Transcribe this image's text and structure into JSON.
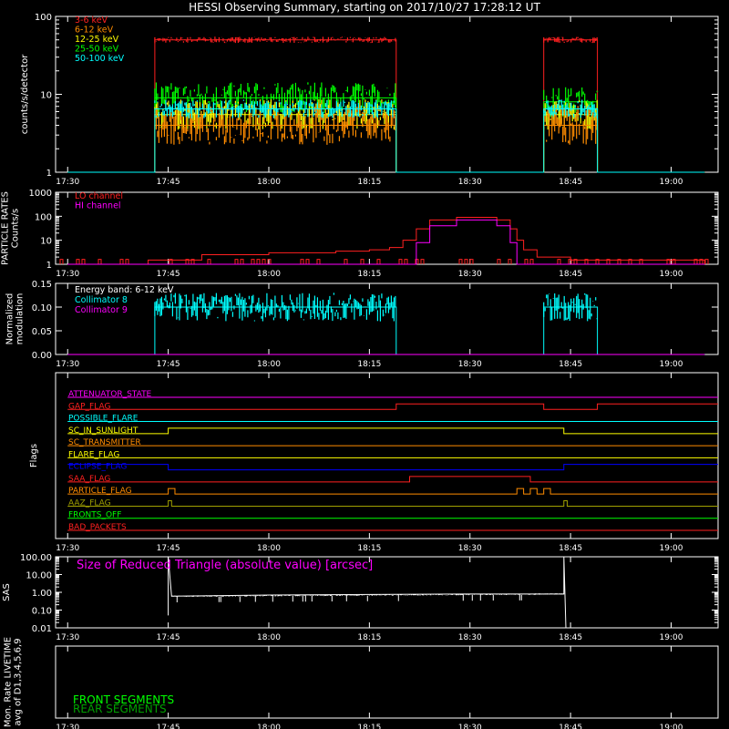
{
  "title": "HESSI Observing Summary, starting on 2017/10/27 17:28:12 UT",
  "time_ticks": [
    "17:30",
    "17:45",
    "18:00",
    "18:15",
    "18:30",
    "18:45",
    "19:00"
  ],
  "colors": {
    "red": "#ff2020",
    "orange": "#ff8c00",
    "yellow": "#ffff00",
    "green": "#00ff00",
    "cyan": "#00ffff",
    "magenta": "#ff00ff",
    "blue": "#0000ff",
    "white": "#ffffff",
    "olive": "#a0a000",
    "darkgreen": "#00a000"
  },
  "chart_data": [
    {
      "type": "line",
      "name": "count-rates",
      "ylabel": "counts/s/detector",
      "yscale": "log",
      "ylim": [
        1,
        100
      ],
      "ytick_labels": [
        "1",
        "10",
        "100"
      ],
      "x_unit": "UT time",
      "series": [
        {
          "name": "3-6 keV",
          "color": "red",
          "noise": 0.04,
          "points": [
            [
              "17:30",
              1
            ],
            [
              "17:43",
              1
            ],
            [
              "17:43",
              50
            ],
            [
              "18:19",
              50
            ],
            [
              "18:19",
              1
            ],
            [
              "18:41",
              1
            ],
            [
              "18:41",
              50
            ],
            [
              "18:49",
              50
            ],
            [
              "18:49",
              1
            ],
            [
              "19:05",
              1
            ]
          ]
        },
        {
          "name": "6-12 keV",
          "color": "orange",
          "noise": 0.25,
          "points": [
            [
              "17:30",
              1
            ],
            [
              "17:43",
              1
            ],
            [
              "17:43",
              4
            ],
            [
              "18:19",
              4
            ],
            [
              "18:19",
              1
            ],
            [
              "18:41",
              1
            ],
            [
              "18:41",
              4
            ],
            [
              "18:49",
              4
            ],
            [
              "18:49",
              1
            ],
            [
              "19:05",
              1
            ]
          ]
        },
        {
          "name": "12-25 keV",
          "color": "yellow",
          "noise": 0.2,
          "points": [
            [
              "17:30",
              1
            ],
            [
              "17:43",
              1
            ],
            [
              "17:43",
              5.5
            ],
            [
              "18:19",
              5.5
            ],
            [
              "18:19",
              1
            ],
            [
              "18:41",
              1
            ],
            [
              "18:41",
              5.5
            ],
            [
              "18:49",
              5.5
            ],
            [
              "18:49",
              1
            ],
            [
              "19:05",
              1
            ]
          ]
        },
        {
          "name": "25-50 keV",
          "color": "green",
          "noise": 0.2,
          "points": [
            [
              "17:30",
              1
            ],
            [
              "17:43",
              1
            ],
            [
              "17:43",
              9
            ],
            [
              "18:19",
              9
            ],
            [
              "18:19",
              1
            ],
            [
              "18:41",
              1
            ],
            [
              "18:41",
              8
            ],
            [
              "18:49",
              8
            ],
            [
              "18:49",
              1
            ],
            [
              "19:05",
              1
            ]
          ]
        },
        {
          "name": "50-100 keV",
          "color": "cyan",
          "noise": 0.12,
          "points": [
            [
              "17:30",
              1
            ],
            [
              "17:43",
              1
            ],
            [
              "17:43",
              6.5
            ],
            [
              "18:19",
              6.5
            ],
            [
              "18:19",
              1
            ],
            [
              "18:41",
              1
            ],
            [
              "18:41",
              6.5
            ],
            [
              "18:49",
              6.5
            ],
            [
              "18:49",
              1
            ],
            [
              "19:05",
              1
            ]
          ]
        }
      ]
    },
    {
      "type": "line",
      "name": "particle-rates",
      "ylabel": "PARTICLE RATES Counts/s",
      "yscale": "log",
      "ylim": [
        1,
        1000
      ],
      "ytick_labels": [
        "1",
        "10",
        "100",
        "1000"
      ],
      "series": [
        {
          "name": "LO channel",
          "color": "red",
          "points": [
            [
              "17:30",
              1
            ],
            [
              "17:42",
              1.5
            ],
            [
              "17:50",
              2.5
            ],
            [
              "18:00",
              3
            ],
            [
              "18:10",
              3.5
            ],
            [
              "18:15",
              4
            ],
            [
              "18:18",
              5
            ],
            [
              "18:20",
              10
            ],
            [
              "18:22",
              30
            ],
            [
              "18:24",
              70
            ],
            [
              "18:28",
              90
            ],
            [
              "18:32",
              90
            ],
            [
              "18:34",
              70
            ],
            [
              "18:36",
              30
            ],
            [
              "18:37",
              10
            ],
            [
              "18:38",
              4
            ],
            [
              "18:40",
              2
            ],
            [
              "18:45",
              1.5
            ],
            [
              "19:05",
              1
            ]
          ]
        },
        {
          "name": "HI channel",
          "color": "magenta",
          "points": [
            [
              "17:30",
              1
            ],
            [
              "18:21",
              1
            ],
            [
              "18:22",
              8
            ],
            [
              "18:24",
              40
            ],
            [
              "18:28",
              70
            ],
            [
              "18:32",
              70
            ],
            [
              "18:34",
              40
            ],
            [
              "18:36",
              8
            ],
            [
              "18:37",
              1
            ],
            [
              "19:05",
              1
            ]
          ]
        }
      ]
    },
    {
      "type": "line",
      "name": "modulation",
      "ylabel": "Normalized modulation",
      "ylim": [
        0.0,
        0.15
      ],
      "ytick_labels": [
        "0.00",
        "0.05",
        "0.10",
        "0.15"
      ],
      "annotation": "Energy band: 6-12 keV",
      "series": [
        {
          "name": "Collimator 8",
          "color": "cyan",
          "noise": 0.03,
          "points": [
            [
              "17:30",
              0
            ],
            [
              "17:43",
              0
            ],
            [
              "17:43",
              0.1
            ],
            [
              "18:19",
              0.1
            ],
            [
              "18:19",
              0
            ],
            [
              "18:41",
              0
            ],
            [
              "18:41",
              0.1
            ],
            [
              "18:49",
              0.1
            ],
            [
              "18:49",
              0
            ],
            [
              "19:05",
              0
            ]
          ]
        },
        {
          "name": "Collimator 9",
          "color": "magenta",
          "points": [
            [
              "17:30",
              0
            ],
            [
              "19:05",
              0
            ]
          ]
        }
      ]
    },
    {
      "type": "line",
      "name": "flags",
      "ylabel": "Flags",
      "series": [
        {
          "name": "ATTENUATOR_STATE",
          "color": "magenta",
          "segments": [
            [
              "17:30",
              0
            ],
            [
              "19:05",
              0
            ]
          ]
        },
        {
          "name": "GAP_FLAG",
          "color": "red",
          "segments": [
            [
              "17:30",
              0
            ],
            [
              "18:19",
              1
            ],
            [
              "18:41",
              0
            ],
            [
              "18:49",
              1
            ]
          ]
        },
        {
          "name": "POSSIBLE_FLARE",
          "color": "cyan",
          "segments": [
            [
              "17:30",
              0
            ]
          ]
        },
        {
          "name": "SC_IN_SUNLIGHT",
          "color": "yellow",
          "segments": [
            [
              "17:30",
              0
            ],
            [
              "17:45",
              1
            ],
            [
              "18:44",
              0
            ]
          ]
        },
        {
          "name": "SC_TRANSMITTER",
          "color": "orange",
          "segments": [
            [
              "17:30",
              0
            ]
          ]
        },
        {
          "name": "FLARE_FLAG",
          "color": "yellow",
          "segments": [
            [
              "17:30",
              0
            ]
          ]
        },
        {
          "name": "ECLIPSE_FLAG",
          "color": "blue",
          "segments": [
            [
              "17:30",
              1
            ],
            [
              "17:45",
              0
            ],
            [
              "18:44",
              1
            ]
          ]
        },
        {
          "name": "SAA_FLAG",
          "color": "red",
          "segments": [
            [
              "17:30",
              0
            ],
            [
              "18:21",
              1
            ],
            [
              "18:39",
              0
            ]
          ]
        },
        {
          "name": "PARTICLE_FLAG",
          "color": "orange",
          "segments": [
            [
              "17:30",
              0
            ],
            [
              "17:45",
              1
            ],
            [
              "17:46",
              0
            ],
            [
              "18:37",
              1
            ],
            [
              "18:38",
              0
            ],
            [
              "18:39",
              1
            ],
            [
              "18:40",
              0
            ],
            [
              "18:41",
              1
            ],
            [
              "18:42",
              0
            ]
          ]
        },
        {
          "name": "AAZ_FLAG",
          "color": "olive",
          "segments": [
            [
              "17:30",
              0
            ],
            [
              "17:45",
              1
            ],
            [
              "17:45.5",
              0
            ],
            [
              "18:44",
              1
            ],
            [
              "18:44.5",
              0
            ]
          ]
        },
        {
          "name": "FRONTS_OFF",
          "color": "green",
          "segments": [
            [
              "17:30",
              0
            ]
          ]
        },
        {
          "name": "BAD_PACKETS",
          "color": "red",
          "segments": [
            [
              "17:30",
              0
            ]
          ]
        }
      ]
    },
    {
      "type": "line",
      "name": "sas",
      "ylabel": "SAS",
      "yscale": "log",
      "ylim": [
        0.01,
        100
      ],
      "ytick_labels": [
        "0.01",
        "0.10",
        "1.00",
        "10.00",
        "100.00"
      ],
      "annotation": "Size of Reduced Triangle (absolute value) [arcsec]",
      "series": [
        {
          "name": "Size of Reduced Triangle",
          "color": "white",
          "points": [
            [
              "17:45",
              0.05
            ],
            [
              "17:45",
              100
            ],
            [
              "17:45.5",
              0.6
            ],
            [
              "18:00",
              0.7
            ],
            [
              "18:15",
              0.75
            ],
            [
              "18:30",
              0.8
            ],
            [
              "18:44",
              0.8
            ],
            [
              "18:44",
              100
            ],
            [
              "18:44.3",
              0.01
            ]
          ]
        }
      ]
    },
    {
      "type": "line",
      "name": "livetime",
      "ylabel": "Mon. Rate LIVETIME avg of D1,3,4,5,6,9",
      "series": [
        {
          "name": "FRONT SEGMENTS",
          "color": "green",
          "points": []
        },
        {
          "name": "REAR SEGMENTS",
          "color": "darkgreen",
          "points": []
        }
      ]
    }
  ]
}
